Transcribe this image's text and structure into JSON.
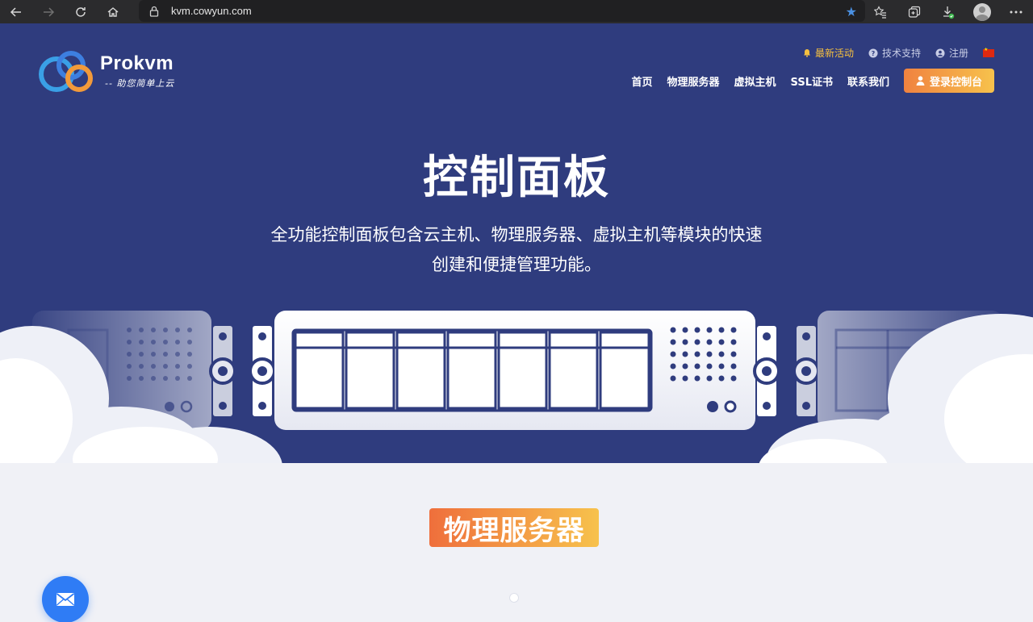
{
  "browser": {
    "url": "kvm.cowyun.com",
    "icons": [
      "back-icon",
      "forward-icon",
      "reload-icon",
      "home-icon",
      "lock-icon",
      "star-icon",
      "favorites-icon",
      "collections-icon",
      "downloads-icon",
      "profile-icon",
      "more-icon"
    ]
  },
  "site": {
    "brand": "Prokvm",
    "slogan": "-- 助您简单上云",
    "topbar": {
      "promo": "最新活动",
      "support": "技术支持",
      "register": "注册"
    },
    "nav": [
      "首页",
      "物理服务器",
      "虚拟主机",
      "SSL证书",
      "联系我们"
    ],
    "login_label": "登录控制台",
    "colors": {
      "hero_bg": "#2f3c7e",
      "accent_start": "#f08240",
      "accent_end": "#f7c24c",
      "fab": "#2f7cf5"
    }
  },
  "hero": {
    "title": "控制面板",
    "desc_line1": "全功能控制面板包含云主机、物理服务器、虚拟主机等模块的快速",
    "desc_line2": "创建和便捷管理功能。"
  },
  "section": {
    "title": "物理服务器"
  }
}
